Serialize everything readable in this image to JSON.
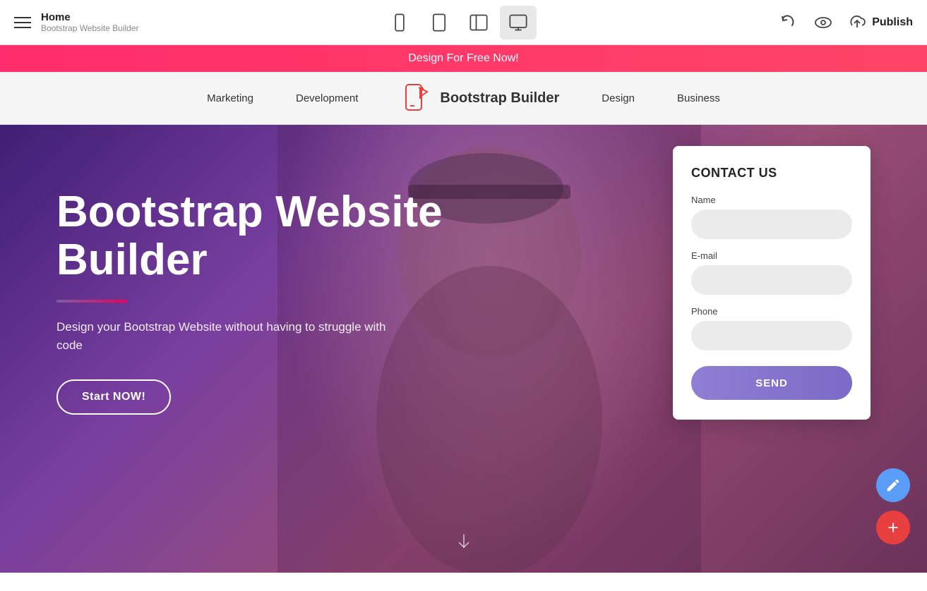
{
  "topBar": {
    "home": "Home",
    "subtitle": "Bootstrap Website Builder",
    "deviceIcons": [
      "mobile",
      "tablet",
      "sidebar",
      "desktop"
    ],
    "publishLabel": "Publish"
  },
  "promo": {
    "text": "Design For Free Now!"
  },
  "nav": {
    "items": [
      "Marketing",
      "Development",
      "Design",
      "Business"
    ],
    "brandName": "Bootstrap Builder"
  },
  "hero": {
    "title": "Bootstrap Website Builder",
    "subtitle": "Design your Bootstrap Website without having to struggle with code",
    "ctaLabel": "Start NOW!"
  },
  "contact": {
    "title": "CONTACT US",
    "fields": [
      {
        "label": "Name",
        "placeholder": ""
      },
      {
        "label": "E-mail",
        "placeholder": ""
      },
      {
        "label": "Phone",
        "placeholder": ""
      }
    ],
    "sendLabel": "SEND"
  },
  "fab": {
    "editLabel": "edit",
    "addLabel": "add"
  }
}
